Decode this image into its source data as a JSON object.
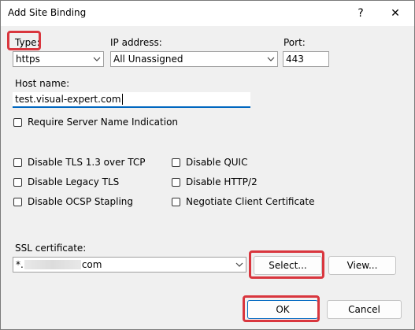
{
  "window": {
    "title": "Add Site Binding",
    "help_label": "?",
    "close_label": "✕"
  },
  "type": {
    "label": "Type:",
    "value": "https"
  },
  "ip": {
    "label": "IP address:",
    "value": "All Unassigned"
  },
  "port": {
    "label": "Port:",
    "value": "443"
  },
  "host": {
    "label": "Host name:",
    "value": "test.visual-expert.com"
  },
  "sni": {
    "label": "Require Server Name Indication"
  },
  "options": {
    "tls13": "Disable TLS 1.3 over TCP",
    "quic": "Disable QUIC",
    "legacy_tls": "Disable Legacy TLS",
    "http2": "Disable HTTP/2",
    "ocsp": "Disable OCSP Stapling",
    "client_cert": "Negotiate Client Certificate"
  },
  "ssl": {
    "label": "SSL certificate:",
    "value_prefix": "*.",
    "value_suffix": "com",
    "select_label": "Select...",
    "view_label": "View..."
  },
  "footer": {
    "ok_label": "OK",
    "cancel_label": "Cancel"
  },
  "colors": {
    "highlight": "#d9363e",
    "focus": "#0067c0"
  }
}
